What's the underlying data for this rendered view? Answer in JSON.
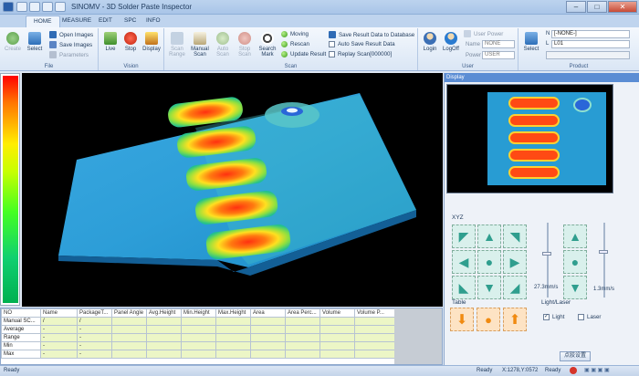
{
  "app": {
    "title": "SINOMV - 3D Solder Paste Inspector"
  },
  "tabs": [
    "HOME",
    "MEASURE",
    "EDIT",
    "SPC",
    "INFO"
  ],
  "ribbon": {
    "file": {
      "label": "File",
      "create": "Create",
      "select": "Select",
      "open_images": "Open Images",
      "save_images": "Save Images",
      "parameters": "Parameters"
    },
    "vision": {
      "label": "Vision",
      "live": "Live",
      "stop": "Stop",
      "display": "Display"
    },
    "scan": {
      "label": "Scan",
      "scan_range": "Scan Range",
      "manual_scan": "Manual Scan",
      "auto_scan": "Auto Scan",
      "stop_scan": "Stop Scan",
      "search_mark": "Search Mark",
      "moving": "Moving",
      "rescan": "Rescan",
      "update_result": "Update Result",
      "save_result_db": "Save Result Data to Database",
      "auto_save": "Auto Save Result Data",
      "replay_scan": "Replay Scan[000000]"
    },
    "user": {
      "label": "User",
      "login": "Login",
      "logoff": "LogOff",
      "user_power": "User Power",
      "name_label": "Name",
      "name_value": "NONE",
      "power_label": "Power",
      "power_value": "USER"
    },
    "product": {
      "label": "Product",
      "select": "Select",
      "n_label": "N",
      "n_value": "[-NONE-]",
      "l_label": "L",
      "l_value": "L01"
    }
  },
  "display": {
    "header": "Display"
  },
  "xyz": {
    "label": "XYZ",
    "speed_xy": "27.3mm/s",
    "speed_z": "1.3mm/s"
  },
  "table_ctl": {
    "label": "Table"
  },
  "light": {
    "label": "Light/Laser",
    "light": "Light",
    "laser": "Laser",
    "light_checked": true,
    "laser_checked": false
  },
  "settings_button": "点胶设置",
  "results": {
    "columns": [
      "NO",
      "Name",
      "PackageT...",
      "Panel Angle",
      "Avg.Height",
      "Min.Height",
      "Max.Height",
      "Area",
      "Area Perc...",
      "Volume",
      "Volume P..."
    ],
    "rows": [
      [
        "Manual SC...",
        "/",
        "/",
        "",
        "",
        "",
        "",
        "",
        "",
        "",
        ""
      ],
      [
        "Average",
        "-",
        "-",
        "",
        "",
        "",
        "",
        "",
        "",
        "",
        ""
      ],
      [
        "Range",
        "-",
        "-",
        "",
        "",
        "",
        "",
        "",
        "",
        "",
        ""
      ],
      [
        "Min",
        "-",
        "-",
        "",
        "",
        "",
        "",
        "",
        "",
        "",
        ""
      ],
      [
        "Max",
        "-",
        "-",
        "",
        "",
        "",
        "",
        "",
        "",
        "",
        ""
      ]
    ]
  },
  "status": {
    "left": "Ready",
    "center": "Ready",
    "coords": "X:1278,Y:0572",
    "right": "Ready"
  },
  "colors": {
    "accent": "#5b8dd4",
    "ribbon_bg": "#dae6f5",
    "table_cell": "#ecf6c6"
  }
}
